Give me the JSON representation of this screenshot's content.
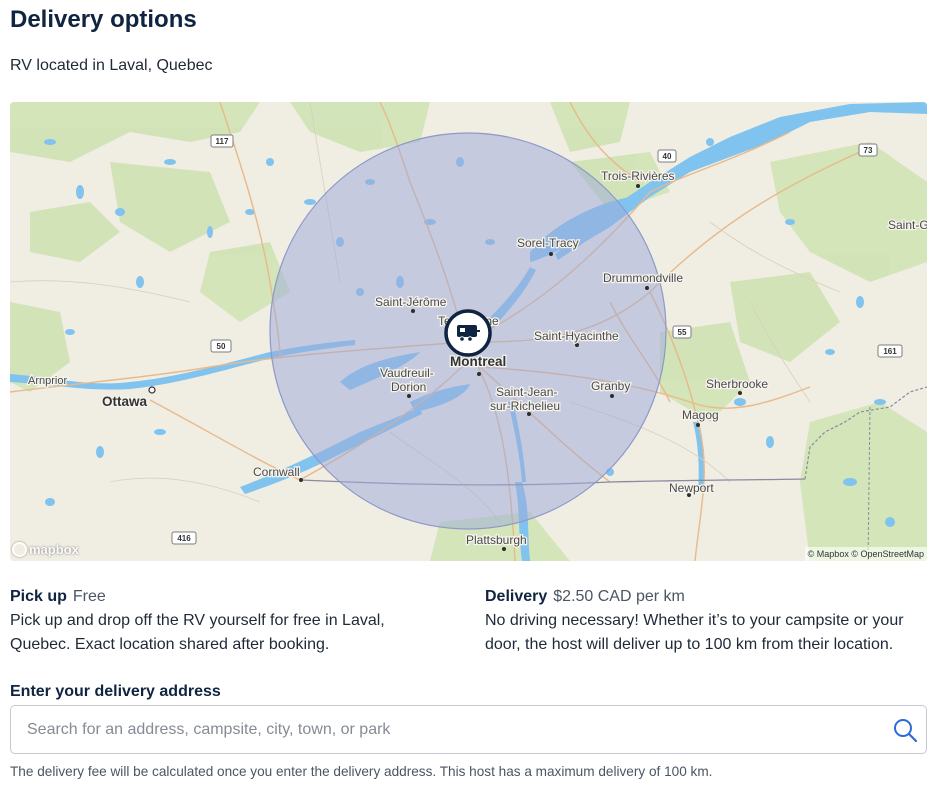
{
  "page": {
    "title": "Delivery options",
    "subtitle": "RV located in Laval, Quebec"
  },
  "map": {
    "places": {
      "trois_rivieres": "Trois-Rivières",
      "sorel_tracy": "Sorel-Tracy",
      "drummondville": "Drummondville",
      "saint_jerome": "Saint-Jérôme",
      "terrebonne": "Terrebonne",
      "saint_hyacinthe": "Saint-Hyacinthe",
      "montreal": "Montreal",
      "vaudreuil_1": "Vaudreuil-",
      "vaudreuil_2": "Dorion",
      "saint_jean_1": "Saint-Jean-",
      "saint_jean_2": "sur-Richelieu",
      "granby": "Granby",
      "sherbrooke": "Sherbrooke",
      "magog": "Magog",
      "newport": "Newport",
      "ottawa": "Ottawa",
      "arnprior": "Arnprior",
      "cornwall": "Cornwall",
      "plattsburgh": "Plattsburgh",
      "saint_g": "Saint-G"
    },
    "shields": {
      "r117": "117",
      "r40": "40",
      "r73": "73",
      "r50": "50",
      "r55": "55",
      "r161": "161",
      "r416": "416"
    },
    "logo_text": "mapbox",
    "attribution": "© Mapbox © OpenStreetMap",
    "marker_icon": "rv-trailer-icon",
    "radius_color": "#9fabd8",
    "marker_color": "#0f2440"
  },
  "pickup": {
    "label": "Pick up",
    "price": "Free",
    "description": "Pick up and drop off the RV yourself for free in Laval, Quebec. Exact location shared after booking."
  },
  "delivery": {
    "label": "Delivery",
    "price": "$2.50 CAD per km",
    "description": "No driving necessary! Whether it’s to your campsite or your door, the host will deliver up to 100 km from their location."
  },
  "address": {
    "label": "Enter your delivery address",
    "placeholder": "Search for an address, campsite, city, town, or park",
    "value": "",
    "note": "The delivery fee will be calculated once you enter the delivery address. This host has a maximum delivery of 100 km."
  }
}
